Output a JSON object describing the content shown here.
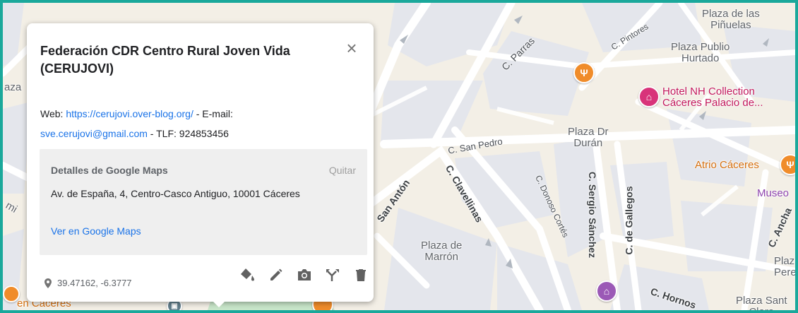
{
  "card": {
    "title": "Federación CDR Centro Rural Joven Vida (CERUJOVI)",
    "close_icon": "close-icon",
    "web_label": "Web: ",
    "web_url": "https://cerujovi.over-blog.org/",
    "email_label": " - E-mail:",
    "email": "sve.cerujovi@gmail.com",
    "phone_label": " - TLF:  924853456",
    "google_maps": {
      "title": "Detalles de Google Maps",
      "remove_label": "Quitar",
      "address": "Av. de España, 4, Centro-Casco Antiguo, 10001 Cáceres",
      "link_label": "Ver en Google Maps"
    },
    "coordinates": "39.47162, -6.3777",
    "tools": [
      "paint-bucket-icon",
      "pencil-icon",
      "camera-icon",
      "directions-icon",
      "trash-icon"
    ]
  },
  "map": {
    "labels": {
      "plaza_pinuelas": "Plaza de las\nPiñuelas",
      "plaza_publio": "Plaza Publio\nHurtado",
      "hotel": "Hotel NH Collection\nCáceres Palacio de...",
      "c_parras": "C. Parras",
      "c_pintores": "C. Pintores",
      "c_san_pedro": "C. San Pedro",
      "plaza_duran": "Plaza Dr\nDurán",
      "atrio": "Atrio Cáceres",
      "museo": "Museo",
      "c_san_anton": "San Antón",
      "c_clavellinas": "C. Clavellinas",
      "c_donoso": "C. Donoso Cortés",
      "c_sergio": "C. Sergio Sánchez",
      "c_gallegos": "C. de Gallegos",
      "c_ancha": "C. Ancha",
      "plaza_marron": "Plaza de\nMarrón",
      "c_hornos": "C. Hornos",
      "plaza_santa": "Plaza Sant\nClara",
      "plaza_pere": "Plaz\nPere",
      "en_caceres": "en Caceres",
      "left_aza": "aza",
      "left_mi": "mi"
    },
    "colors": {
      "border": "#1aa89b",
      "road": "#ffffff",
      "building": "#e6e7eb",
      "land": "#f4f1ea",
      "accent_blue": "#1a73e8"
    }
  }
}
